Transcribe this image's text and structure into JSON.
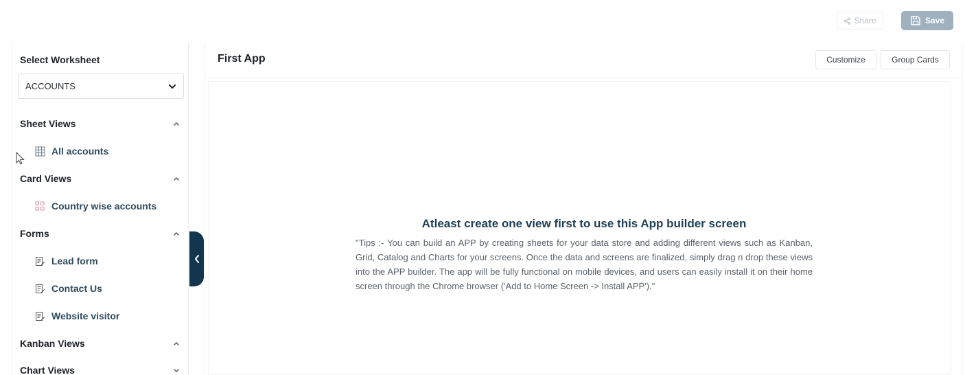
{
  "toolbar": {
    "share_label": "Share",
    "save_label": "Save"
  },
  "sidebar": {
    "title": "Select Worksheet",
    "worksheet_selected": "ACCOUNTS",
    "sections": {
      "sheet_views": {
        "label": "Sheet Views",
        "items": [
          "All accounts"
        ]
      },
      "card_views": {
        "label": "Card Views",
        "items": [
          "Country wise accounts"
        ]
      },
      "forms": {
        "label": "Forms",
        "items": [
          "Lead form",
          "Contact Us",
          "Website visitor"
        ]
      },
      "kanban_views": {
        "label": "Kanban Views"
      },
      "chart_views": {
        "label": "Chart Views"
      }
    }
  },
  "main": {
    "title": "First App",
    "customize_label": "Customize",
    "group_cards_label": "Group Cards",
    "empty_title": "Atleast create one view first to use this App builder screen",
    "tips": "\"Tips :- You can build an APP by creating sheets for your data store and adding different views such as Kanban, Grid, Catalog and Charts for your screens. Once the data and screens are finalized, simply drag n drop these views into the APP builder. The app will be fully functional on mobile devices, and users can easily install it on their home screen through the Chrome browser ('Add to Home Screen -> Install APP').\""
  },
  "colors": {
    "accent_dark": "#12364e",
    "save_button": "#9fb0bf",
    "link_text": "#2e4a5e"
  }
}
